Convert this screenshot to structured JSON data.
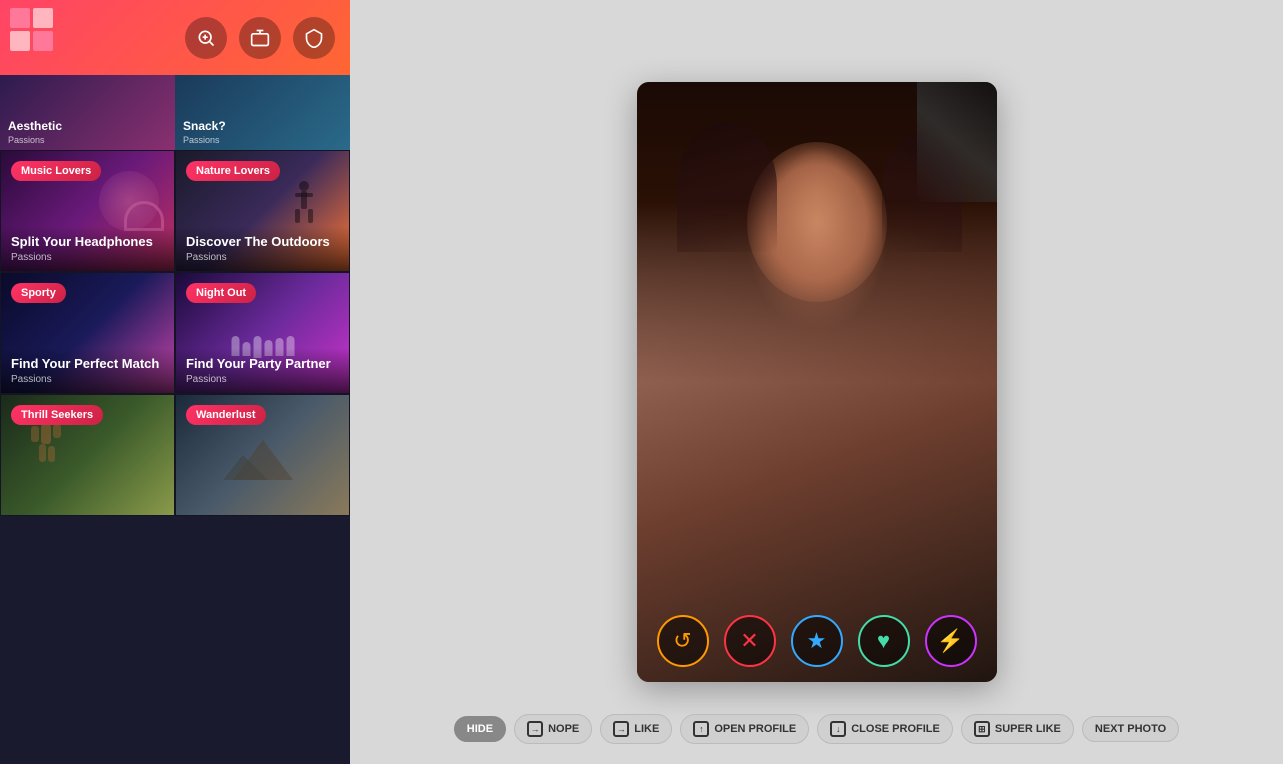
{
  "header": {
    "icons": [
      "search-match",
      "briefcase",
      "shield"
    ]
  },
  "topCards": [
    {
      "title": "Aesthetic",
      "subtitle": "Passions",
      "badge": null
    },
    {
      "title": "Snack?",
      "subtitle": "Passions",
      "badge": null
    }
  ],
  "cards": [
    {
      "id": "music",
      "badge": "Music Lovers",
      "title": "Split Your Headphones",
      "subtitle": "Passions"
    },
    {
      "id": "nature",
      "badge": "Nature Lovers",
      "title": "Discover The Outdoors",
      "subtitle": "Passions"
    },
    {
      "id": "sporty",
      "badge": "Sporty",
      "title": "Find Your Perfect Match",
      "subtitle": "Passions"
    },
    {
      "id": "nightout",
      "badge": "Night Out",
      "title": "Find Your Party Partner",
      "subtitle": "Passions"
    },
    {
      "id": "thrill",
      "badge": "Thrill Seekers",
      "title": "",
      "subtitle": ""
    },
    {
      "id": "wanderlust",
      "badge": "Wanderlust",
      "title": "",
      "subtitle": ""
    }
  ],
  "profile": {
    "name": "",
    "age": ""
  },
  "actionButtons": [
    {
      "id": "rewind",
      "icon": "↺",
      "label": "rewind",
      "colorClass": "btn-rewind"
    },
    {
      "id": "nope",
      "icon": "✕",
      "label": "nope",
      "colorClass": "btn-nope"
    },
    {
      "id": "star",
      "icon": "★",
      "label": "star",
      "colorClass": "btn-star"
    },
    {
      "id": "heart",
      "icon": "♥",
      "label": "heart",
      "colorClass": "btn-heart"
    },
    {
      "id": "boost",
      "icon": "⚡",
      "label": "boost",
      "colorClass": "btn-boost"
    }
  ],
  "toolbar": {
    "hide": "HIDE",
    "nope": "NOPE",
    "like": "LIKE",
    "openProfile": "OPEN PROFILE",
    "closeProfile": "CLOSE PROFILE",
    "superLike": "SUPER LIKE",
    "nextPhoto": "NEXT PHOTO"
  }
}
